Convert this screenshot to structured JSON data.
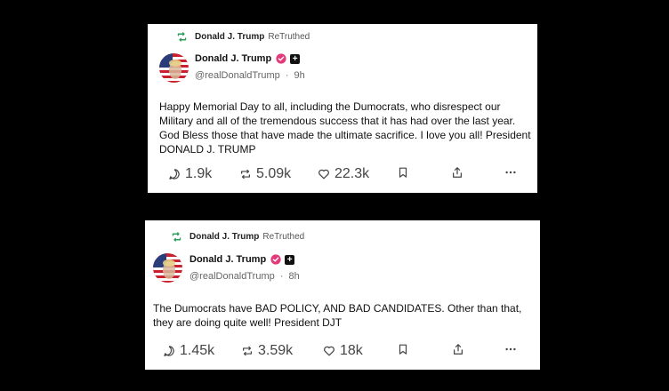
{
  "posts": [
    {
      "retruth_name": "Donald J. Trump",
      "retruth_label": "ReTruthed",
      "author_name": "Donald J. Trump",
      "handle": "@realDonaldTrump",
      "separator": "·",
      "time": "9h",
      "text": "Happy Memorial Day to all, including the Dumocrats, who disrespect our Military and all of the tremendous success that it has had over the last year. God Bless those that have made the ultimate sacrifice. I love you all! President DONALD J. TRUMP",
      "replies": "1.9k",
      "retruths": "5.09k",
      "likes": "22.3k"
    },
    {
      "retruth_name": "Donald J. Trump",
      "retruth_label": "ReTruthed",
      "author_name": "Donald J. Trump",
      "handle": "@realDonaldTrump",
      "separator": "·",
      "time": "8h",
      "text": "The Dumocrats have BAD POLICY, AND BAD CANDIDATES. Other than that, they are doing quite well! President DJT",
      "replies": "1.45k",
      "retruths": "3.59k",
      "likes": "18k"
    }
  ],
  "colors": {
    "retruth_green": "#2e9e5b",
    "verified_pink": "#e23a7a",
    "page_bg": "#000000",
    "card_bg": "#ffffff"
  },
  "icons": [
    "retruth-icon",
    "verified-icon",
    "plus-badge-icon",
    "reply-icon",
    "retruth-action-icon",
    "like-icon",
    "bookmark-icon",
    "share-icon",
    "more-icon"
  ]
}
